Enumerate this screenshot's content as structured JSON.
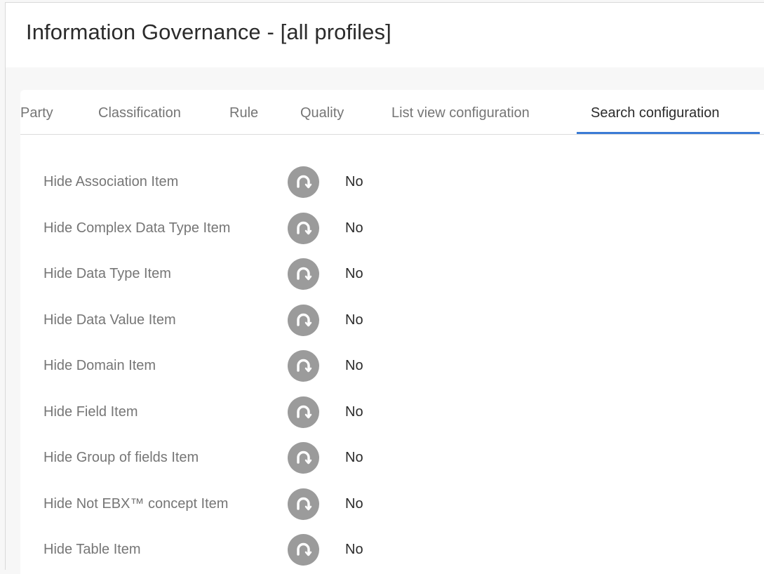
{
  "page": {
    "title": "Information Governance - [all profiles]"
  },
  "tabs": [
    {
      "label": "Party",
      "active": false
    },
    {
      "label": "Classification",
      "active": false
    },
    {
      "label": "Rule",
      "active": false
    },
    {
      "label": "Quality",
      "active": false
    },
    {
      "label": "List view configuration",
      "active": false
    },
    {
      "label": "Search configuration",
      "active": true
    }
  ],
  "fields": [
    {
      "label": "Hide Association Item",
      "value": "No",
      "icon": "inherit-icon"
    },
    {
      "label": "Hide Complex Data Type Item",
      "value": "No",
      "icon": "inherit-icon"
    },
    {
      "label": "Hide Data Type Item",
      "value": "No",
      "icon": "inherit-icon"
    },
    {
      "label": "Hide Data Value Item",
      "value": "No",
      "icon": "inherit-icon"
    },
    {
      "label": "Hide Domain Item",
      "value": "No",
      "icon": "inherit-icon"
    },
    {
      "label": "Hide Field Item",
      "value": "No",
      "icon": "inherit-icon"
    },
    {
      "label": "Hide Group of fields Item",
      "value": "No",
      "icon": "inherit-icon"
    },
    {
      "label": "Hide Not EBX™ concept Item",
      "value": "No",
      "icon": "inherit-icon"
    },
    {
      "label": "Hide Table Item",
      "value": "No",
      "icon": "inherit-icon"
    }
  ],
  "colors": {
    "accent": "#3a7bd5",
    "icon_background": "#9b9b9b",
    "label_text": "#767676",
    "value_text": "#2b2b2b"
  }
}
